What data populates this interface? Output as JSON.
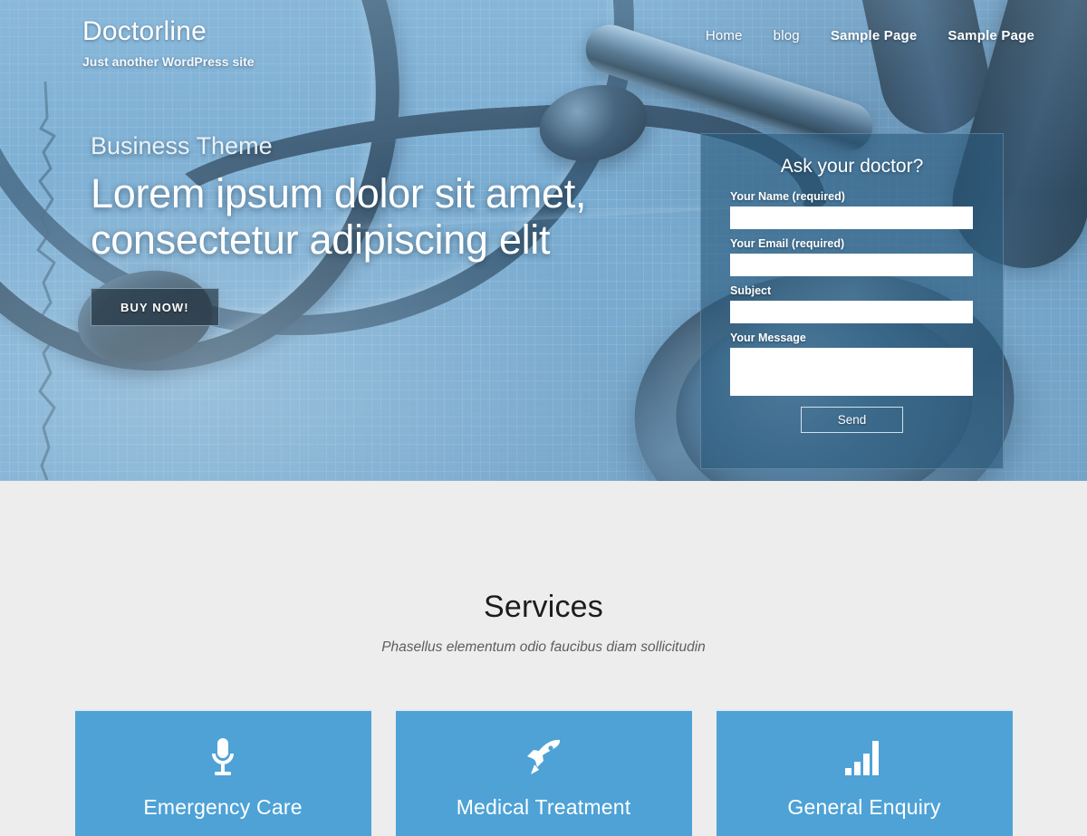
{
  "header": {
    "site_title": "Doctorline",
    "site_description": "Just another WordPress site",
    "nav": [
      {
        "label": "Home",
        "name": "nav-home"
      },
      {
        "label": "blog",
        "name": "nav-blog"
      },
      {
        "label": "Sample Page",
        "name": "nav-sample-page-1"
      },
      {
        "label": "Sample Page",
        "name": "nav-sample-page-2"
      }
    ]
  },
  "hero": {
    "eyebrow": "Business Theme",
    "title": "Lorem ipsum dolor sit amet, consectetur adipiscing elit",
    "cta_label": "BUY NOW!",
    "background_image": "stethoscope-on-ekg-graph-paper"
  },
  "contact_form": {
    "title": "Ask your doctor?",
    "fields": [
      {
        "label": "Your Name (required)",
        "value": "",
        "placeholder": "",
        "type": "text",
        "name": "your-name-field"
      },
      {
        "label": "Your Email (required)",
        "value": "",
        "placeholder": "",
        "type": "text",
        "name": "your-email-field"
      },
      {
        "label": "Subject",
        "value": "",
        "placeholder": "",
        "type": "text",
        "name": "subject-field"
      }
    ],
    "message": {
      "label": "Your Message",
      "value": "",
      "placeholder": "",
      "name": "your-message-field"
    },
    "submit_label": "Send"
  },
  "services": {
    "title": "Services",
    "subtitle": "Phasellus elementum odio faucibus diam sollicitudin",
    "cards": [
      {
        "label": "Emergency Care",
        "icon": "microphone-icon"
      },
      {
        "label": "Medical Treatment",
        "icon": "rocket-icon"
      },
      {
        "label": "General Enquiry",
        "icon": "signal-bars-icon"
      }
    ]
  },
  "colors": {
    "accent_blue": "#4ea2d6",
    "panel_blue": "#2c5c7e",
    "section_bg": "#ededed",
    "text_dark": "#1c1c1c"
  }
}
